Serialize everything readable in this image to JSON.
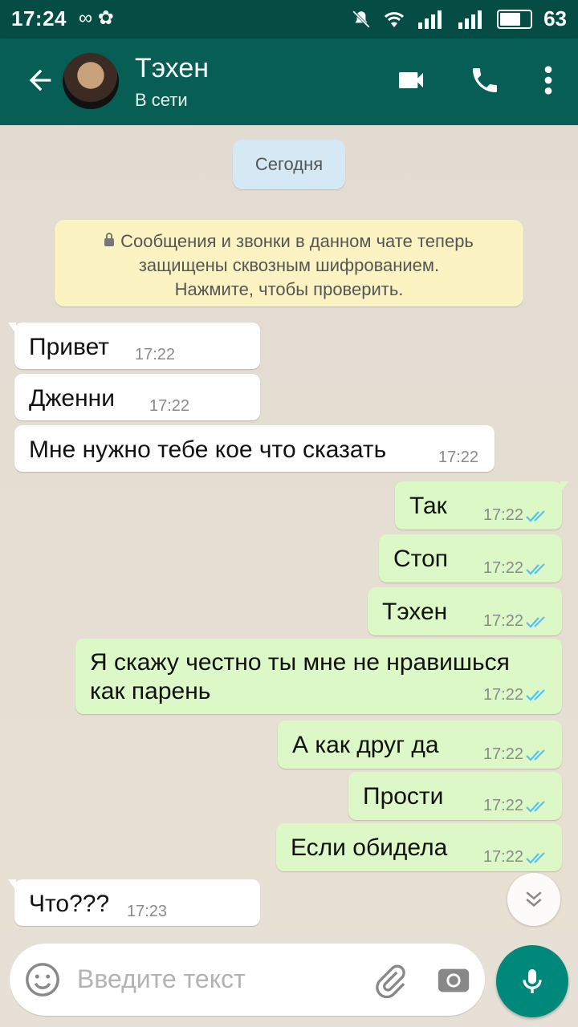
{
  "status_bar": {
    "time": "17:24",
    "left_icons": "∞ ✿",
    "battery": "63"
  },
  "header": {
    "contact_name": "Тэхен",
    "contact_status": "В сети"
  },
  "chat": {
    "date_chip": "Сегодня",
    "encryption_notice": {
      "line1": "Сообщения и звонки в данном чате теперь",
      "line2": "защищены сквозным шифрованием.",
      "line3": "Нажмите, чтобы проверить."
    },
    "messages": [
      {
        "dir": "in",
        "text": "Привет",
        "time": "17:22"
      },
      {
        "dir": "in",
        "text": "Дженни",
        "time": "17:22"
      },
      {
        "dir": "in",
        "text": "Мне нужно тебе кое что сказать",
        "time": "17:22"
      },
      {
        "dir": "out",
        "text": "Так",
        "time": "17:22"
      },
      {
        "dir": "out",
        "text": "Стоп",
        "time": "17:22"
      },
      {
        "dir": "out",
        "text": "Тэхен",
        "time": "17:22"
      },
      {
        "dir": "out",
        "text_line1": "Я скажу честно ты мне не нравишься",
        "text_line2": "как парень",
        "time": "17:22"
      },
      {
        "dir": "out",
        "text": "А как друг да",
        "time": "17:22"
      },
      {
        "dir": "out",
        "text": "Прости",
        "time": "17:22"
      },
      {
        "dir": "out",
        "text": "Если обидела",
        "time": "17:22"
      },
      {
        "dir": "in",
        "text": "Что???",
        "time": "17:23"
      }
    ]
  },
  "composer": {
    "placeholder": "Введите текст"
  },
  "colors": {
    "header": "#075e54",
    "status_bar": "#054d44",
    "outgoing_bubble": "#dcf8c6",
    "incoming_bubble": "#ffffff",
    "read_ticks": "#4fc3f7",
    "mic_button": "#00897b"
  },
  "icons": {
    "back": "arrow-left-icon",
    "video": "video-camera-icon",
    "call": "phone-icon",
    "menu": "more-vertical-icon",
    "emoji": "emoji-icon",
    "attach": "paperclip-icon",
    "camera": "camera-icon",
    "mic": "microphone-icon",
    "scroll": "chevrons-down-icon"
  }
}
